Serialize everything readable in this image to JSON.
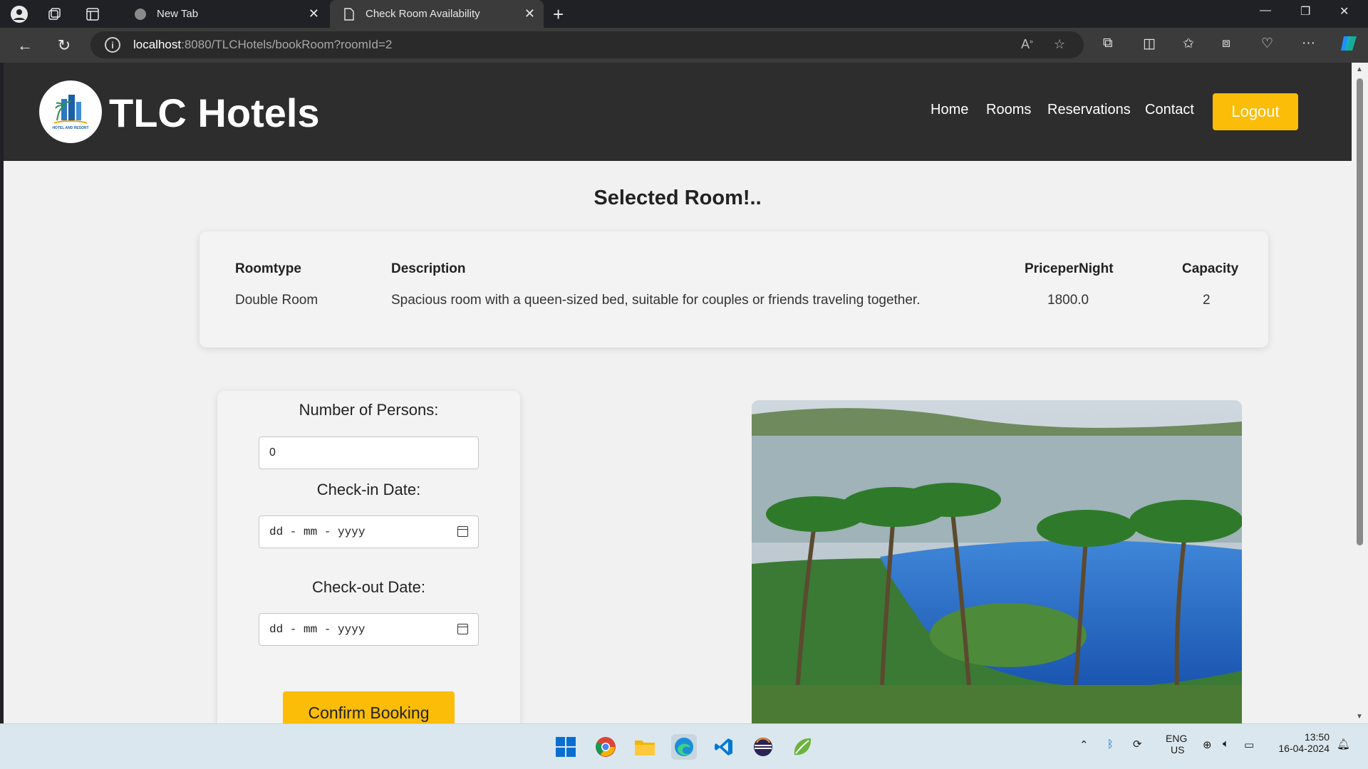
{
  "browser": {
    "tabs": [
      {
        "title": "New Tab",
        "active": false
      },
      {
        "title": "Check Room Availability",
        "active": true
      }
    ],
    "url_host": "localhost",
    "url_rest": ":8080/TLCHotels/bookRoom?roomId=2"
  },
  "site": {
    "brand": "TLC Hotels",
    "logo_text": "HOTEL AND RESORT",
    "nav": [
      "Home",
      "Rooms",
      "Reservations",
      "Contact"
    ],
    "logout_label": "Logout",
    "accent_color": "#fbbd08"
  },
  "main": {
    "title": "Selected Room!..",
    "room_table": {
      "headers": [
        "Roomtype",
        "Description",
        "PriceperNight",
        "Capacity"
      ],
      "row": [
        "Double Room",
        "Spacious room with a queen-sized bed, suitable for couples or friends traveling together.",
        "1800.0",
        "2"
      ]
    },
    "form": {
      "persons_label": "Number of Persons:",
      "persons_value": "0",
      "checkin_label": "Check-in Date:",
      "checkin_placeholder": "dd - mm - yyyy",
      "checkout_label": "Check-out Date:",
      "checkout_placeholder": "dd - mm - yyyy",
      "confirm_label": "Confirm Booking"
    }
  },
  "taskbar": {
    "lang_top": "ENG",
    "lang_bottom": "US",
    "time": "13:50",
    "date": "16-04-2024"
  }
}
